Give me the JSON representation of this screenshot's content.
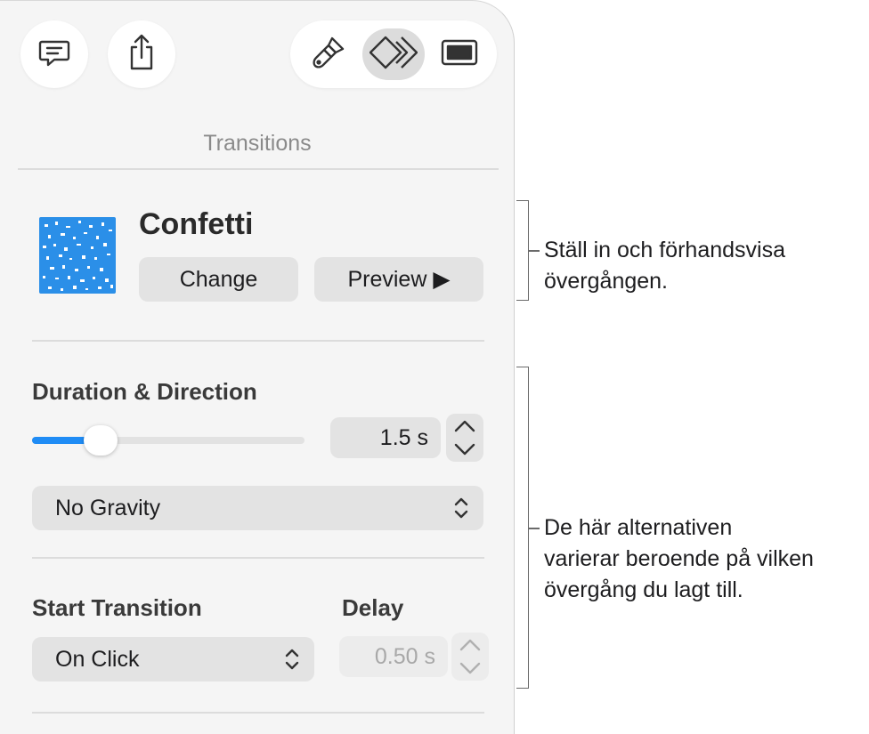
{
  "panel": {
    "section_title": "Transitions",
    "toolbar": {
      "comment_icon": "comment-icon",
      "share_icon": "share-icon",
      "format_icon": "paintbrush-icon",
      "animate_icon": "animate-diamond-icon",
      "document_icon": "document-icon",
      "active_tab": "animate"
    },
    "transition": {
      "name": "Confetti",
      "change_label": "Change",
      "preview_label": "Preview ▶"
    },
    "duration": {
      "label": "Duration & Direction",
      "value": "1.5 s",
      "slider_fraction": 0.25,
      "direction_value": "No Gravity"
    },
    "start": {
      "label": "Start Transition",
      "value": "On Click",
      "delay_label": "Delay",
      "delay_value": "0.50 s",
      "delay_enabled": false
    },
    "accent_color": "#1f8cf5"
  },
  "callouts": {
    "top": {
      "line1": "Ställ in och förhandsvisa",
      "line2": "övergången."
    },
    "bottom": {
      "line1": "De här alternativen",
      "line2": "varierar beroende på vilken",
      "line3": "övergång du lagt till."
    }
  }
}
